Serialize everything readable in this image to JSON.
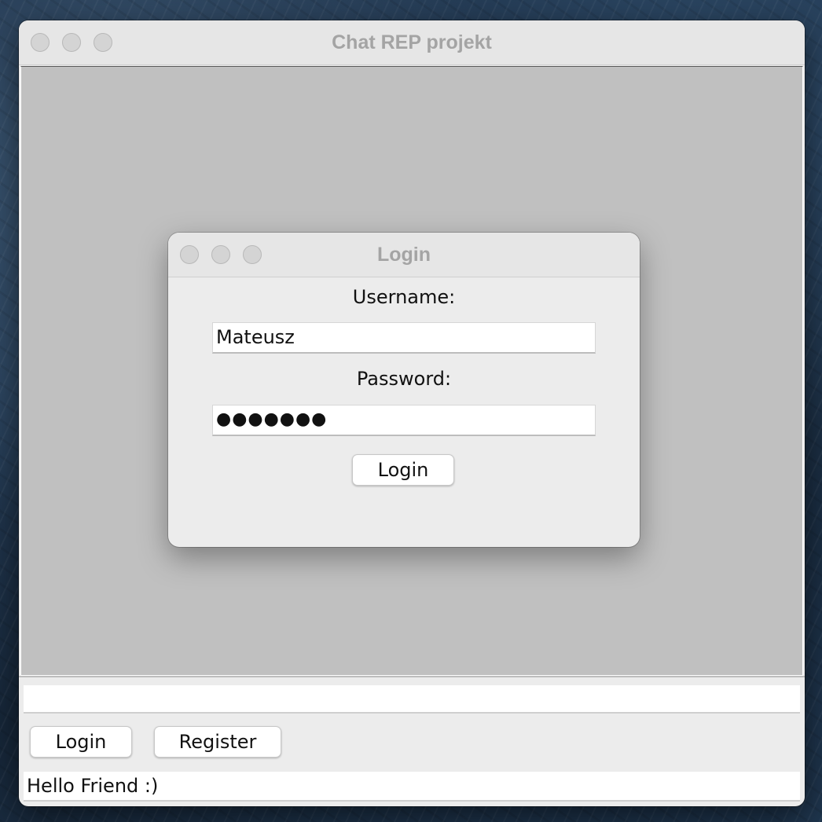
{
  "main_window": {
    "title": "Chat REP projekt",
    "message_input": {
      "value": "",
      "placeholder": ""
    },
    "buttons": {
      "login_label": "Login",
      "register_label": "Register"
    },
    "status_text": "Hello Friend :)"
  },
  "login_dialog": {
    "title": "Login",
    "username_label": "Username:",
    "username_value": "Mateusz",
    "password_label": "Password:",
    "password_masked": "●●●●●●●",
    "submit_label": "Login"
  },
  "colors": {
    "window_bg": "#ececec",
    "desktop_pane": "#c0c0c0",
    "title_text": "#a4a4a4"
  }
}
